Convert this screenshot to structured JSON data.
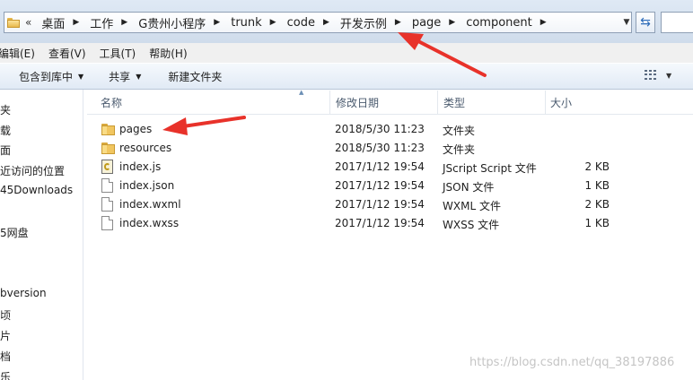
{
  "address_bar": {
    "overflow_chevrons": "«",
    "crumbs": [
      "桌面",
      "工作",
      "G贵州小程序",
      "trunk",
      "code",
      "开发示例",
      "page",
      "component"
    ]
  },
  "menu": [
    "编辑(E)",
    "查看(V)",
    "工具(T)",
    "帮助(H)"
  ],
  "toolbar": {
    "include_in_library": "包含到库中",
    "share": "共享",
    "new_folder": "新建文件夹"
  },
  "nav": [
    "夹",
    "载",
    "面",
    "近访问的位置",
    "45Downloads",
    "5网盘",
    "bversion",
    "顷",
    "片",
    "档",
    "乐"
  ],
  "columns": {
    "name": "名称",
    "modified": "修改日期",
    "type": "类型",
    "size": "大小"
  },
  "files": [
    {
      "name": "pages",
      "icon": "folder-icon",
      "modified": "2018/5/30 11:23",
      "type": "文件夹",
      "size": ""
    },
    {
      "name": "resources",
      "icon": "folder-icon",
      "modified": "2018/5/30 11:23",
      "type": "文件夹",
      "size": ""
    },
    {
      "name": "index.js",
      "icon": "jscript-file-icon",
      "modified": "2017/1/12 19:54",
      "type": "JScript Script 文件",
      "size": "2 KB"
    },
    {
      "name": "index.json",
      "icon": "file-icon",
      "modified": "2017/1/12 19:54",
      "type": "JSON 文件",
      "size": "1 KB"
    },
    {
      "name": "index.wxml",
      "icon": "file-icon",
      "modified": "2017/1/12 19:54",
      "type": "WXML 文件",
      "size": "2 KB"
    },
    {
      "name": "index.wxss",
      "icon": "file-icon",
      "modified": "2017/1/12 19:54",
      "type": "WXSS 文件",
      "size": "1 KB"
    }
  ],
  "watermark": "https://blog.csdn.net/qq_38197886",
  "colors": {
    "arrow": "#e8322a",
    "address_bg": "#dfe9f5",
    "toolbar_bg": "#e1eaf5"
  }
}
